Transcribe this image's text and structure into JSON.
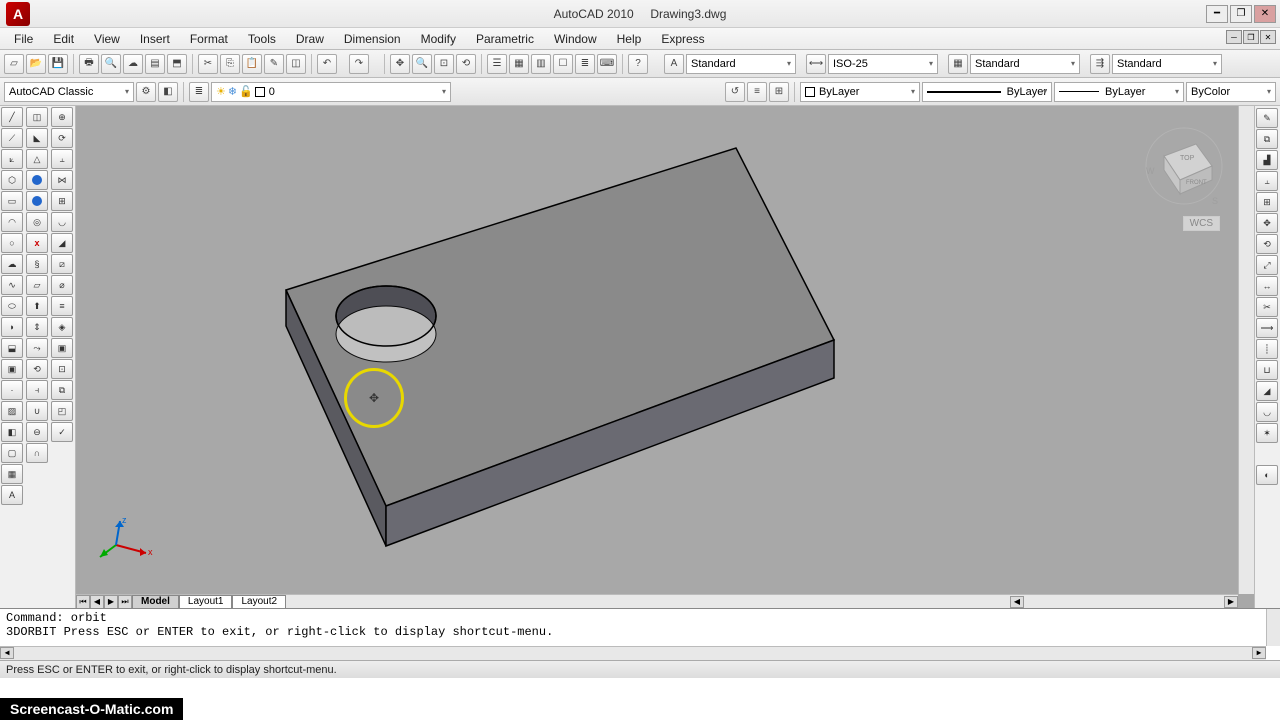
{
  "app": {
    "title_left": "AutoCAD 2010",
    "title_right": "Drawing3.dwg"
  },
  "menu": [
    "File",
    "Edit",
    "View",
    "Insert",
    "Format",
    "Tools",
    "Draw",
    "Dimension",
    "Modify",
    "Parametric",
    "Window",
    "Help",
    "Express"
  ],
  "toolbar1": {
    "workspace": "AutoCAD Classic",
    "text_style": "Standard",
    "dim_style": "ISO-25",
    "table_style": "Standard",
    "ml_style": "Standard"
  },
  "layers": {
    "current": "0",
    "layer_color": "ByLayer",
    "linetype": "ByLayer",
    "lineweight": "ByLayer",
    "plot_style": "ByColor"
  },
  "tabs": {
    "model": "Model",
    "layout1": "Layout1",
    "layout2": "Layout2"
  },
  "wcs": "WCS",
  "command": {
    "line1": "Command: orbit",
    "line2": "3DORBIT Press ESC or ENTER to exit, or right-click to display shortcut-menu."
  },
  "status": "Press ESC or ENTER to exit, or right-click to display shortcut-menu.",
  "watermark": "Screencast-O-Matic.com",
  "viewcube": {
    "top": "TOP",
    "front": "FRONT",
    "s": "S",
    "w": "W"
  }
}
